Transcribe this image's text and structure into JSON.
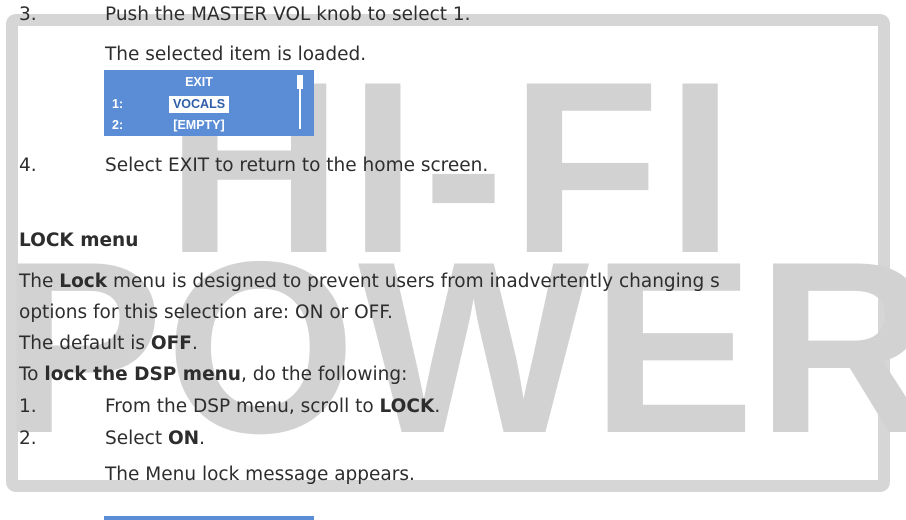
{
  "watermark": {
    "line1": "HI-FI",
    "line2": "POWER"
  },
  "step3": {
    "num": "3.",
    "text": "Push the MASTER VOL knob to select 1.",
    "result": "The selected item is loaded."
  },
  "lcd": {
    "title": "EXIT",
    "rows": [
      {
        "index": "1:",
        "value": "VOCALS",
        "selected": true
      },
      {
        "index": "2:",
        "value": "[EMPTY]",
        "selected": false
      }
    ],
    "background": "#5a8dd6"
  },
  "step4": {
    "num": "4.",
    "text": "Select EXIT to return to the home screen."
  },
  "lock_section": {
    "heading": "LOCK menu",
    "p1_pre": "The ",
    "p1_bold": "Lock",
    "p1_post": " menu is designed to prevent users from inadvertently changing s",
    "p2": "options for this selection are: ON or OFF.",
    "p3_pre": "The default is ",
    "p3_bold": "OFF",
    "p3_post": ".",
    "p4_pre": "To ",
    "p4_bold": "lock the DSP menu",
    "p4_post": ", do the following:",
    "steps": [
      {
        "num": "1.",
        "pre": "From the DSP menu, scroll to ",
        "bold": "LOCK",
        "post": "."
      },
      {
        "num": "2.",
        "pre": "Select ",
        "bold": "ON",
        "post": "."
      }
    ],
    "step2_result": "The Menu lock message appears."
  }
}
